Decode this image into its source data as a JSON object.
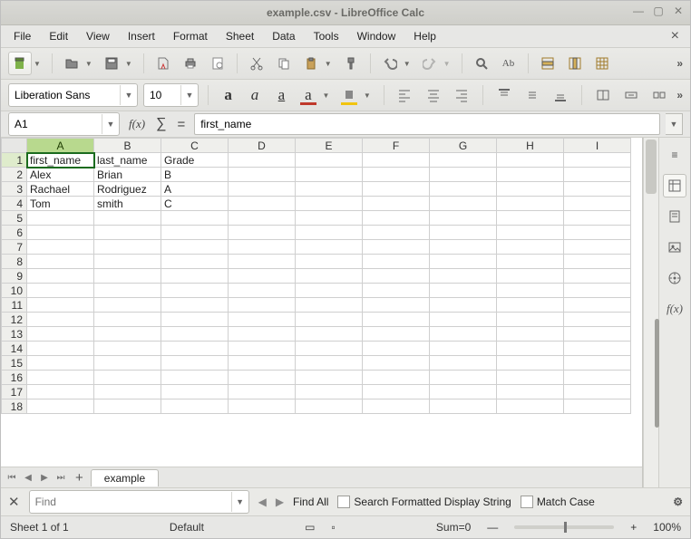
{
  "window": {
    "title": "example.csv - LibreOffice Calc"
  },
  "menu": {
    "items": [
      "File",
      "Edit",
      "View",
      "Insert",
      "Format",
      "Sheet",
      "Data",
      "Tools",
      "Window",
      "Help"
    ]
  },
  "format": {
    "font_name": "Liberation Sans",
    "font_size": "10"
  },
  "namebox": {
    "ref": "A1"
  },
  "formula": {
    "value": "first_name"
  },
  "columns": [
    "A",
    "B",
    "C",
    "D",
    "E",
    "F",
    "G",
    "H",
    "I"
  ],
  "active_col": "A",
  "active_row": 1,
  "row_count": 18,
  "cells": {
    "1": [
      "first_name",
      "last_name",
      "Grade"
    ],
    "2": [
      "Alex",
      "Brian",
      "B"
    ],
    "3": [
      "Rachael",
      "Rodriguez",
      "A"
    ],
    "4": [
      "Tom",
      "smith",
      "C"
    ]
  },
  "tabs": {
    "sheet": "example"
  },
  "find": {
    "placeholder": "Find",
    "find_all": "Find All",
    "formatted": "Search Formatted Display String",
    "match_case": "Match Case"
  },
  "status": {
    "sheet": "Sheet 1 of 1",
    "style": "Default",
    "sum": "Sum=0",
    "zoom": "100%"
  },
  "chart_data": {
    "type": "table",
    "columns": [
      "first_name",
      "last_name",
      "Grade"
    ],
    "rows": [
      [
        "Alex",
        "Brian",
        "B"
      ],
      [
        "Rachael",
        "Rodriguez",
        "A"
      ],
      [
        "Tom",
        "smith",
        "C"
      ]
    ]
  }
}
